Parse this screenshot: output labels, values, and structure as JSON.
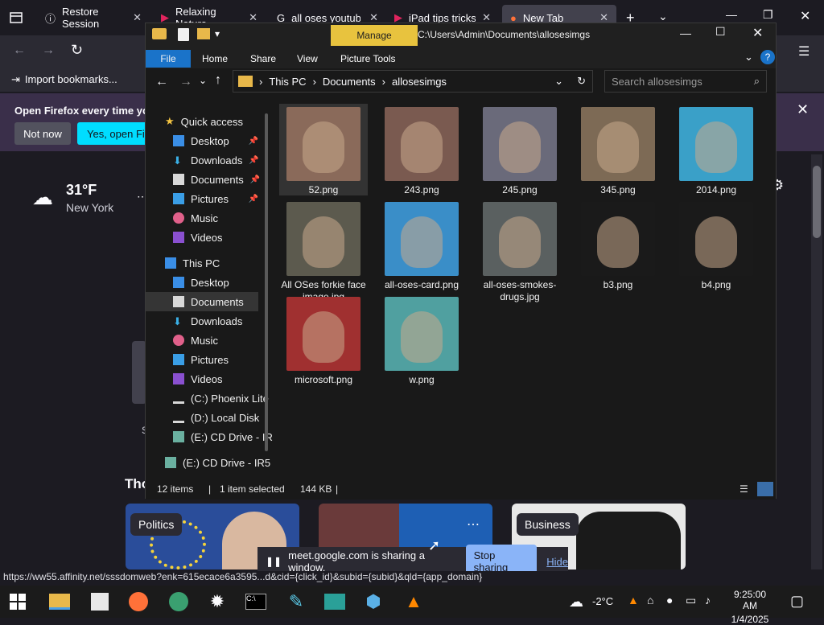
{
  "firefox": {
    "tabs": [
      {
        "label": "Restore Session",
        "active": false
      },
      {
        "label": "Relaxing Nature",
        "active": false
      },
      {
        "label": "all oses youtube",
        "active": false
      },
      {
        "label": "iPad tips tricks a",
        "active": false
      },
      {
        "label": "New Tab",
        "active": true
      }
    ],
    "bookmark_import": "Import bookmarks...",
    "notice_text": "Open Firefox every time you",
    "notice_not_now": "Not now",
    "notice_yes": "Yes, open Fire",
    "weather_temp": "31°F",
    "weather_city": "New York",
    "section_heading": "Tho",
    "cards": [
      {
        "tag": "Politics"
      },
      {
        "tag": "Business"
      }
    ],
    "status_url": "https://ww55.affinity.net/sssdomweb?enk=615ecace6a3595...d&cid={click_id}&subid={subid}&qld={app_domain}",
    "share_text": "meet.google.com is sharing a window.",
    "share_stop": "Stop sharing",
    "share_hide": "Hide"
  },
  "explorer": {
    "ribbon_context": "Manage",
    "path_title": "C:\\Users\\Admin\\Documents\\allosesimgs",
    "ribbon_tabs": [
      "File",
      "Home",
      "Share",
      "View",
      "Picture Tools"
    ],
    "breadcrumb": [
      "This PC",
      "Documents",
      "allosesimgs"
    ],
    "search_placeholder": "Search allosesimgs",
    "nav": {
      "quick_access": "Quick access",
      "quick_items": [
        "Desktop",
        "Downloads",
        "Documents",
        "Pictures",
        "Music",
        "Videos"
      ],
      "this_pc": "This PC",
      "pc_items": [
        "Desktop",
        "Documents",
        "Downloads",
        "Music",
        "Pictures",
        "Videos",
        "(C:) Phoenix Lite",
        "(D:) Local Disk",
        "(E:) CD Drive - IR"
      ],
      "cd_drive": "(E:) CD Drive - IR5"
    },
    "files": [
      {
        "name": "52.png",
        "bg": "#8a6a5a"
      },
      {
        "name": "243.png",
        "bg": "#7a5a50"
      },
      {
        "name": "245.png",
        "bg": "#6a6a7a"
      },
      {
        "name": "345.png",
        "bg": "#7d6a55"
      },
      {
        "name": "2014.png",
        "bg": "#3aa0c8"
      },
      {
        "name": "All OSes forkie face image.jpg",
        "bg": "#5c5a4e"
      },
      {
        "name": "all-oses-card.png",
        "bg": "#3a8ec8"
      },
      {
        "name": "all-oses-smokes-drugs.jpg",
        "bg": "#5a6060"
      },
      {
        "name": "b3.png",
        "bg": "#1a1a1a"
      },
      {
        "name": "b4.png",
        "bg": "#1a1a1a"
      },
      {
        "name": "microsoft.png",
        "bg": "#a03030"
      },
      {
        "name": "w.png",
        "bg": "#50a0a0"
      }
    ],
    "status_items": "12 items",
    "status_selected": "1 item selected",
    "status_size": "144 KB"
  },
  "taskbar": {
    "weather": "-2°C",
    "time": "9:25:00 AM",
    "date": "1/4/2025"
  }
}
